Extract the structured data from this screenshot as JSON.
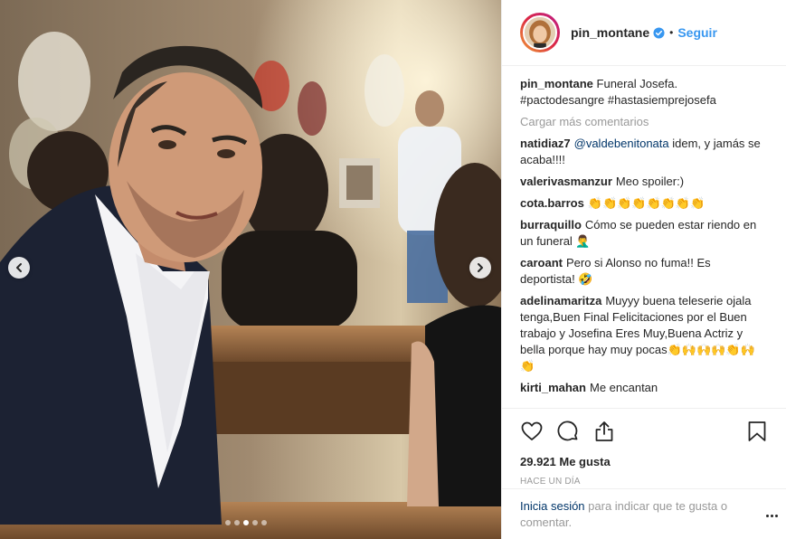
{
  "post": {
    "username": "pin_montane",
    "follow_label": "Seguir",
    "separator": "•",
    "caption_text": "Funeral Josefa.",
    "hashtags": [
      "#pactodesangre",
      "#hastasiemprejosefa"
    ],
    "load_more": "Cargar más comentarios",
    "comments": [
      {
        "user": "natidiaz7",
        "mention": "@valdebenitonata",
        "text": " idem, y jamás se acaba!!!!"
      },
      {
        "user": "valerivasmanzur",
        "text": "Meo spoiler:)"
      },
      {
        "user": "cota.barros",
        "text": "👏👏👏👏👏👏👏👏"
      },
      {
        "user": "burraquillo",
        "text": "Cómo se pueden estar riendo en un funeral 🤦‍♂️"
      },
      {
        "user": "caroant",
        "text": "Pero si Alonso no fuma!! Es deportista! 🤣"
      },
      {
        "user": "adelinamaritza",
        "text": "Muyyy buena teleserie ojala tenga,Buen Final Felicitaciones por el Buen trabajo y Josefina Eres Muy,Buena Actriz y bella porque hay muy pocas👏🙌🙌🙌👏🙌👏"
      },
      {
        "user": "kirti_mahan",
        "text": "Me encantan"
      }
    ],
    "likes": "29.921 Me gusta",
    "time": "HACE UN DÍA",
    "login_link": "Inicia sesión",
    "login_text": " para indicar que te gusta o comentar."
  },
  "icons": {
    "verified": "verified-badge-icon",
    "like": "heart-icon",
    "comment": "comment-icon",
    "share": "share-icon",
    "save": "bookmark-icon",
    "prev": "chevron-left-icon",
    "next": "chevron-right-icon",
    "more": "more-options-icon"
  },
  "carousel": {
    "slides": 5,
    "active_index": 2
  },
  "colors": {
    "link": "#3897f0",
    "tag": "#003569",
    "muted": "#999999",
    "text": "#262626"
  }
}
